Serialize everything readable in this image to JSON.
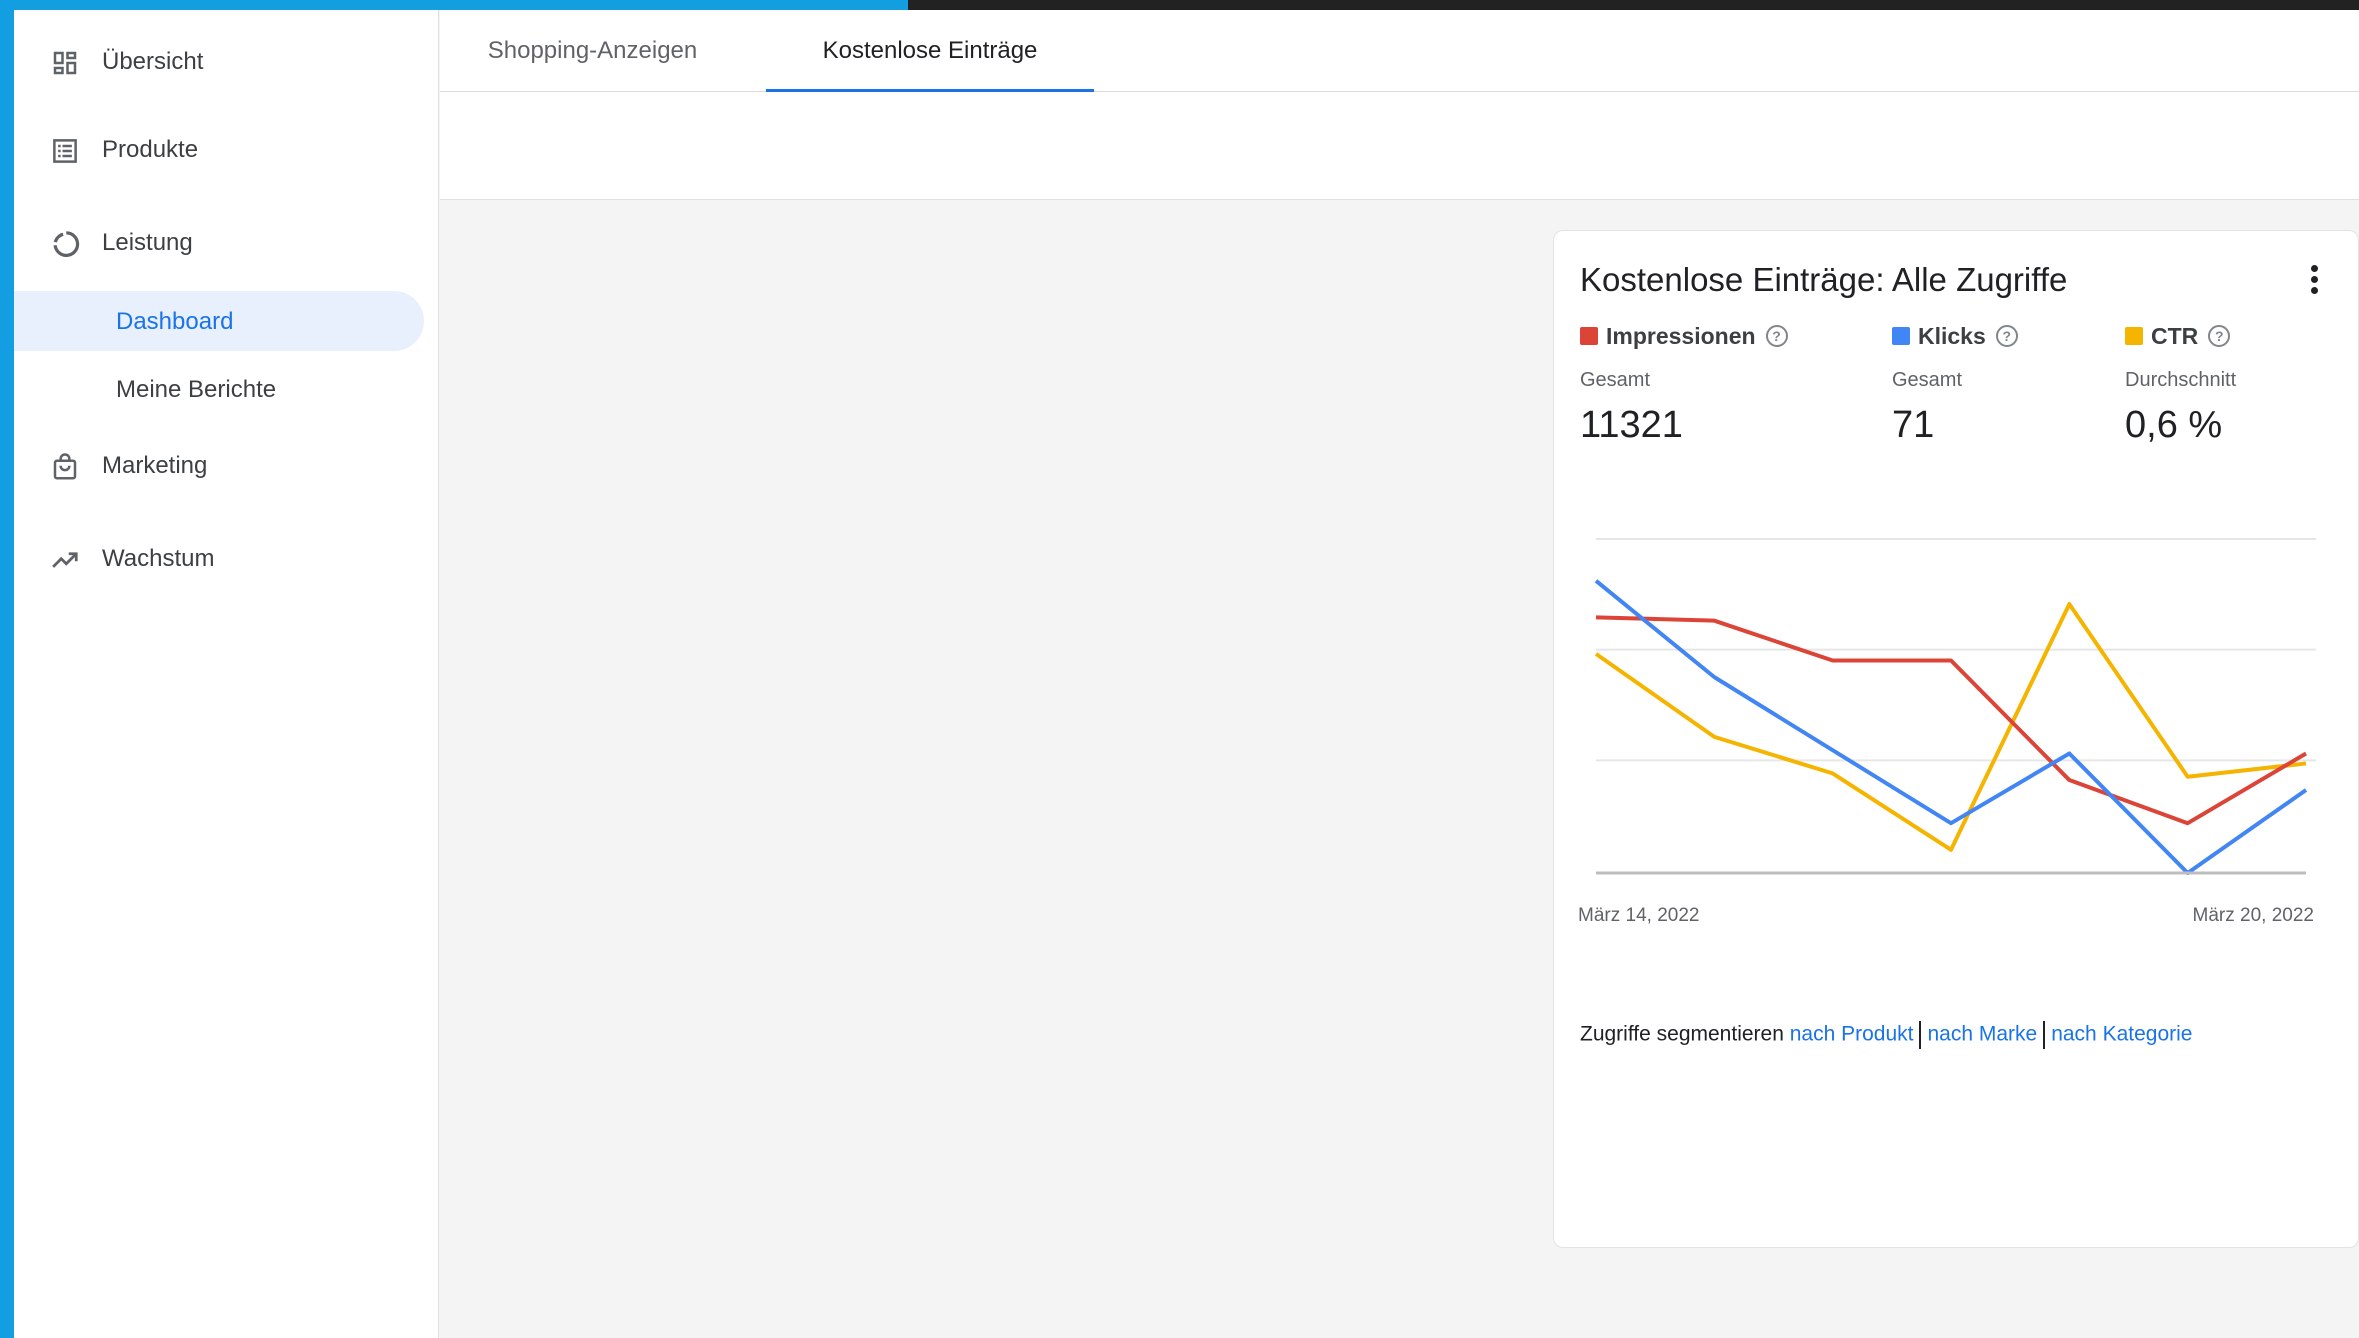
{
  "nav": {
    "items": [
      {
        "label": "Übersicht",
        "icon": "dashboard-grid-icon"
      },
      {
        "label": "Produkte",
        "icon": "product-list-icon"
      },
      {
        "label": "Leistung",
        "icon": "performance-ring-icon"
      },
      {
        "label": "Marketing",
        "icon": "shopping-bag-icon"
      },
      {
        "label": "Wachstum",
        "icon": "trending-up-icon"
      }
    ],
    "sub_items": [
      {
        "label": "Dashboard",
        "active": true
      },
      {
        "label": "Meine Berichte",
        "active": false
      }
    ]
  },
  "tabs": [
    {
      "label": "Shopping-Anzeigen",
      "active": false
    },
    {
      "label": "Kostenlose Einträge",
      "active": true
    }
  ],
  "card": {
    "title": "Kostenlose Einträge: Alle Zugriffe",
    "more_icon": "more-vert-icon",
    "metrics": [
      {
        "name": "Impressionen",
        "sub": "Gesamt",
        "value": "11321",
        "color": "#db4437",
        "help_icon": "help-circle-icon",
        "help_glyph": "?"
      },
      {
        "name": "Klicks",
        "sub": "Gesamt",
        "value": "71",
        "color": "#4285f4",
        "help_icon": "help-circle-icon",
        "help_glyph": "?"
      },
      {
        "name": "CTR",
        "sub": "Durchschnitt",
        "value": "0,6 %",
        "color": "#f4b400",
        "help_icon": "help-circle-icon",
        "help_glyph": "?"
      }
    ],
    "segment": {
      "prefix": "Zugriffe segmentieren",
      "links": [
        "nach Produkt",
        "nach Marke",
        "nach Kategorie"
      ]
    }
  },
  "chart_data": {
    "type": "line",
    "x": [
      "2022-03-14",
      "2022-03-15",
      "2022-03-16",
      "2022-03-17",
      "2022-03-18",
      "2022-03-19",
      "2022-03-20"
    ],
    "x_tick_labels": [
      "März 14, 2022",
      "März 20, 2022"
    ],
    "grid": true,
    "normalized": true,
    "ylim": [
      0,
      1
    ],
    "series": [
      {
        "name": "Impressionen",
        "color": "#db4437",
        "values": [
          0.77,
          0.76,
          0.64,
          0.64,
          0.28,
          0.15,
          0.36
        ]
      },
      {
        "name": "Klicks",
        "color": "#4285f4",
        "values": [
          0.88,
          0.59,
          0.37,
          0.15,
          0.36,
          0.0,
          0.25
        ]
      },
      {
        "name": "CTR",
        "color": "#f4b400",
        "values": [
          0.66,
          0.41,
          0.3,
          0.07,
          0.81,
          0.29,
          0.33
        ]
      }
    ]
  }
}
